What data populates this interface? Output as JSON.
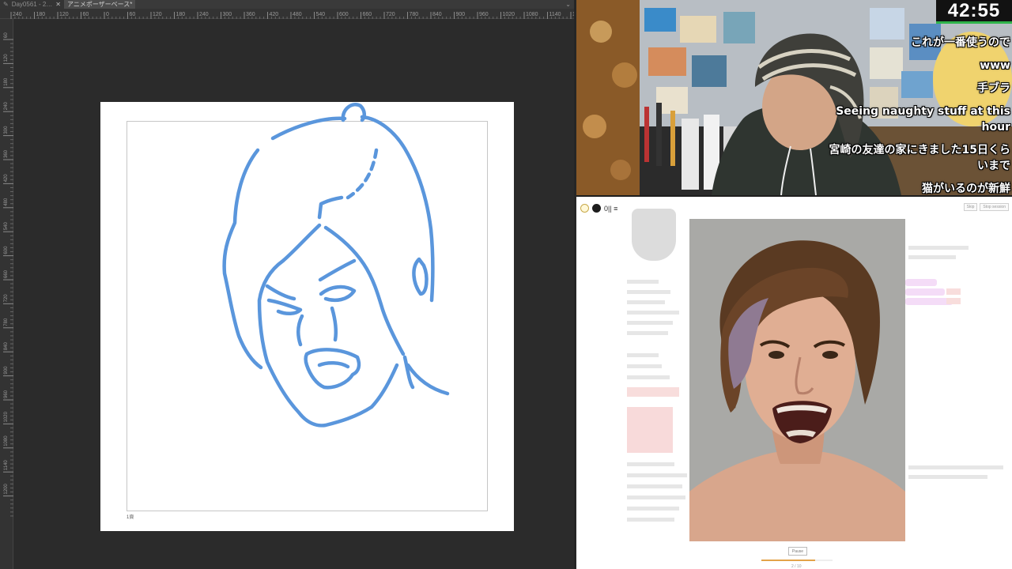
{
  "app": {
    "tabs": [
      {
        "label": "Day0561 - 2…",
        "active": false
      },
      {
        "label": "アニメポーザーベース*",
        "active": true
      }
    ],
    "tab_close_icon": "close-icon",
    "hruler_ticks": [
      "240",
      "180",
      "120",
      "60",
      "0",
      "60",
      "120",
      "180",
      "240",
      "300",
      "360",
      "420",
      "480",
      "540",
      "600",
      "660",
      "720",
      "780",
      "840",
      "900",
      "960",
      "1020",
      "1080",
      "1140",
      "1200",
      "1260"
    ],
    "vruler_ticks": [
      "60",
      "120",
      "180",
      "240",
      "300",
      "360",
      "420",
      "480",
      "540",
      "600",
      "660",
      "720",
      "780",
      "840",
      "900",
      "960",
      "1020",
      "1080",
      "1140",
      "1200"
    ],
    "page_number": "1頁",
    "stroke_color": "#5a96dc"
  },
  "stream": {
    "timer": "42:55",
    "timer_accent": "#2fb34a",
    "comments": [
      "これが一番使うので",
      "www",
      "手ブラ",
      "Seeing naughty stuff at this hour",
      "宮崎の友達の家にきました15日くらいまで",
      "猫がいるのが新鮮"
    ]
  },
  "browser": {
    "toolbar_text": "0|| ≡",
    "top_buttons": [
      "Skip",
      "Stop session"
    ],
    "pause_label": "Pause",
    "page_count": "2 / 10",
    "progress": 0.75
  }
}
